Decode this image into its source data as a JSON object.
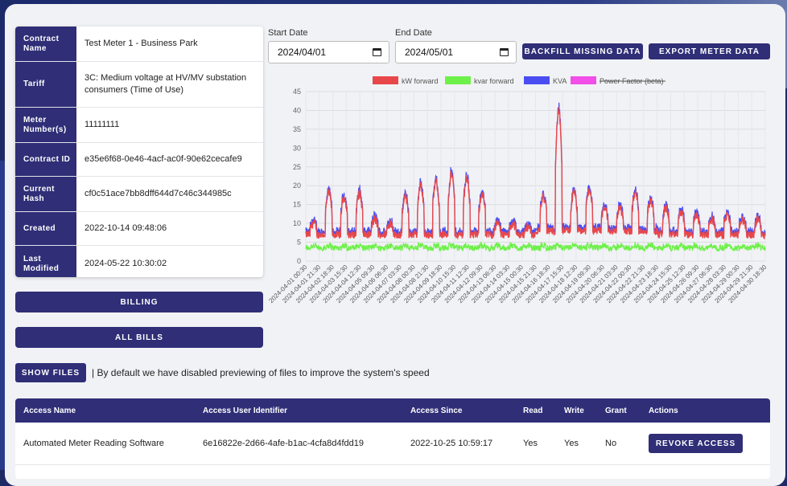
{
  "contract": {
    "rows": [
      {
        "label": "Contract Name",
        "value": "Test Meter 1 - Business Park"
      },
      {
        "label": "Tariff",
        "value": "3C: Medium voltage at HV/MV substation consumers (Time of Use)"
      },
      {
        "label": "Meter Number(s)",
        "value": "11111111"
      },
      {
        "label": "Contract ID",
        "value": "e35e6f68-0e46-4acf-ac0f-90e62cecafe9"
      },
      {
        "label": "Current Hash",
        "value": "cf0c51ace7bb8dff644d7c46c344985c"
      },
      {
        "label": "Created",
        "value": "2022-10-14 09:48:06"
      },
      {
        "label": "Last Modified",
        "value": "2024-05-22 10:30:02"
      }
    ]
  },
  "buttons": {
    "billing": "BILLING",
    "all_bills": "ALL BILLS",
    "backfill": "BACKFILL MISSING DATA",
    "export": "EXPORT METER DATA",
    "show_files": "SHOW FILES"
  },
  "dates": {
    "start_label": "Start Date",
    "start_value": "2024/04/01",
    "end_label": "End Date",
    "end_value": "2024/05/01"
  },
  "files_note": "| By default we have disabled previewing of files to improve the system's speed",
  "chart_data": {
    "type": "line",
    "title": "",
    "xlabel": "",
    "ylabel": "",
    "ylim": [
      0,
      45
    ],
    "yticks": [
      0,
      5,
      10,
      15,
      20,
      25,
      30,
      35,
      40,
      45
    ],
    "grid": true,
    "legend_position": "top-center",
    "x_tick_labels": [
      "2024-04-01 00:30",
      "2024-04-01 21:30",
      "2024-04-02 18:30",
      "2024-04-03 15:30",
      "2024-04-04 12:30",
      "2024-04-05 09:30",
      "2024-04-06 06:30",
      "2024-04-07 03:30",
      "2024-04-08 00:30",
      "2024-04-08 21:30",
      "2024-04-09 18:30",
      "2024-04-10 15:30",
      "2024-04-11 12:30",
      "2024-04-12 09:30",
      "2024-04-13 06:30",
      "2024-04-14 03:30",
      "2024-04-15 00:30",
      "2024-04-15 21:30",
      "2024-04-16 18:30",
      "2024-04-17 15:30",
      "2024-04-18 12:30",
      "2024-04-19 09:30",
      "2024-04-20 06:30",
      "2024-04-21 03:30",
      "2024-04-22 00:30",
      "2024-04-22 21:30",
      "2024-04-23 18:30",
      "2024-04-24 15:30",
      "2024-04-25 12:30",
      "2024-04-26 09:30",
      "2024-04-27 06:30",
      "2024-04-28 03:30",
      "2024-04-29 00:30",
      "2024-04-29 21:30",
      "2024-04-30 18:30"
    ],
    "daily_peak_kw": [
      10,
      18,
      17,
      16,
      18,
      11,
      10,
      17,
      20,
      21,
      20,
      23,
      22,
      18,
      10,
      10,
      9,
      24,
      17,
      40,
      18,
      19,
      14,
      14,
      19,
      18,
      16,
      14,
      13,
      12,
      11,
      12,
      12,
      11,
      11
    ],
    "daily_base_kw": [
      7,
      7,
      7,
      7,
      7,
      7,
      7,
      7,
      7,
      7,
      7,
      7,
      7,
      7,
      7,
      7,
      7,
      8,
      8,
      8,
      8,
      8,
      8,
      8,
      8,
      8,
      8,
      7,
      7,
      7,
      7,
      7,
      7,
      7,
      7
    ],
    "kvar_level": 3.5,
    "series": [
      {
        "name": "kW forward",
        "color": "#e8474a"
      },
      {
        "name": "kvar forward",
        "color": "#6ef04a"
      },
      {
        "name": "KVA",
        "color": "#4a4ef2"
      },
      {
        "name": "Power Factor (beta)",
        "color": "#f24ee8",
        "hidden": true
      }
    ]
  },
  "access": {
    "headers": [
      "Access Name",
      "Access User Identifier",
      "Access Since",
      "Read",
      "Write",
      "Grant",
      "Actions"
    ],
    "rows": [
      {
        "name": "Automated Meter Reading Software",
        "identifier": "6e16822e-2d66-4afe-b1ac-4cfa8d4fdd19",
        "since": "2022-10-25 10:59:17",
        "read": "Yes",
        "write": "Yes",
        "grant": "No",
        "action": "REVOKE ACCESS"
      }
    ]
  },
  "colors": {
    "primary": "#2f2e77",
    "background": "#f1f2f5",
    "page_bg": "#1e2a66"
  }
}
